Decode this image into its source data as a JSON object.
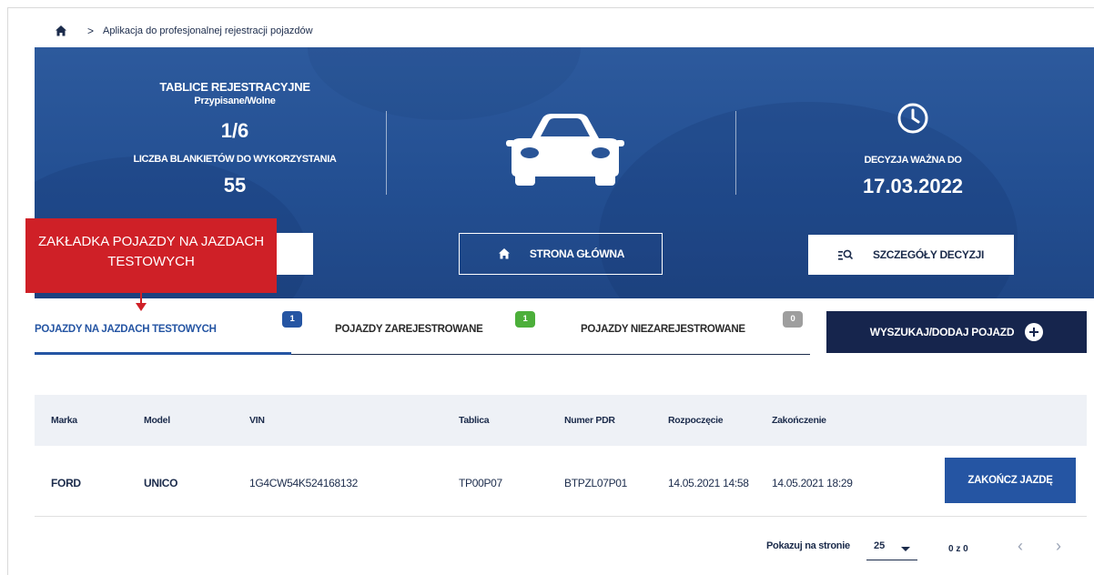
{
  "breadcrumb": {
    "home_icon": "home-icon",
    "separator": ">",
    "current": "Aplikacja do profesjonalnej rejestracji pojazdów"
  },
  "hero": {
    "plates_title": "TABLICE REJESTRACYJNE",
    "plates_sub": "Przypisane/Wolne",
    "plates_value": "1/6",
    "blanks_label": "LICZBA BLANKIETÓW DO WYKORZYSTANIA",
    "blanks_value": "55",
    "car_icon": "car-icon",
    "clock_icon": "clock-icon",
    "decision_label": "DECYZJA WAŻNA DO",
    "decision_date": "17.03.2022",
    "home_button": "STRONA GŁÓWNA",
    "details_button": "SZCZEGÓŁY DECYZJI"
  },
  "callout": {
    "text": "ZAKŁADKA POJAZDY NA JAZDACH TESTOWYCH",
    "color": "#cf2027"
  },
  "tabs": [
    {
      "label": "POJAZDY NA JAZDACH TESTOWYCH",
      "badge": "1",
      "badge_color": "#2555a3",
      "active": true
    },
    {
      "label": "POJAZDY ZAREJESTROWANE",
      "badge": "1",
      "badge_color": "#4caf3a",
      "active": false
    },
    {
      "label": "POJAZDY NIEZAREJESTROWANE",
      "badge": "0",
      "badge_color": "#9e9e9e",
      "active": false
    }
  ],
  "search_button": "WYSZUKAJ/DODAJ POJAZD",
  "table": {
    "columns": [
      "Marka",
      "Model",
      "VIN",
      "Tablica",
      "Numer PDR",
      "Rozpoczęcie",
      "Zakończenie"
    ],
    "rows": [
      {
        "marka": "FORD",
        "model": "UNICO",
        "vin": "1G4CW54K524168132",
        "tablica": "TP00P07",
        "numer_pdr": "BTPZL07P01",
        "rozpoczecie": "14.05.2021 14:58",
        "zakonczenie": "14.05.2021 18:29",
        "action": "ZAKOŃCZ JAZDĘ"
      }
    ]
  },
  "pagination": {
    "per_page_label": "Pokazuj na stronie",
    "per_page_value": "25",
    "range": "0 z 0",
    "prev": "‹",
    "next": "›"
  },
  "colors": {
    "primary": "#2555a3",
    "dark": "#16254d",
    "hero": "#234f92"
  }
}
